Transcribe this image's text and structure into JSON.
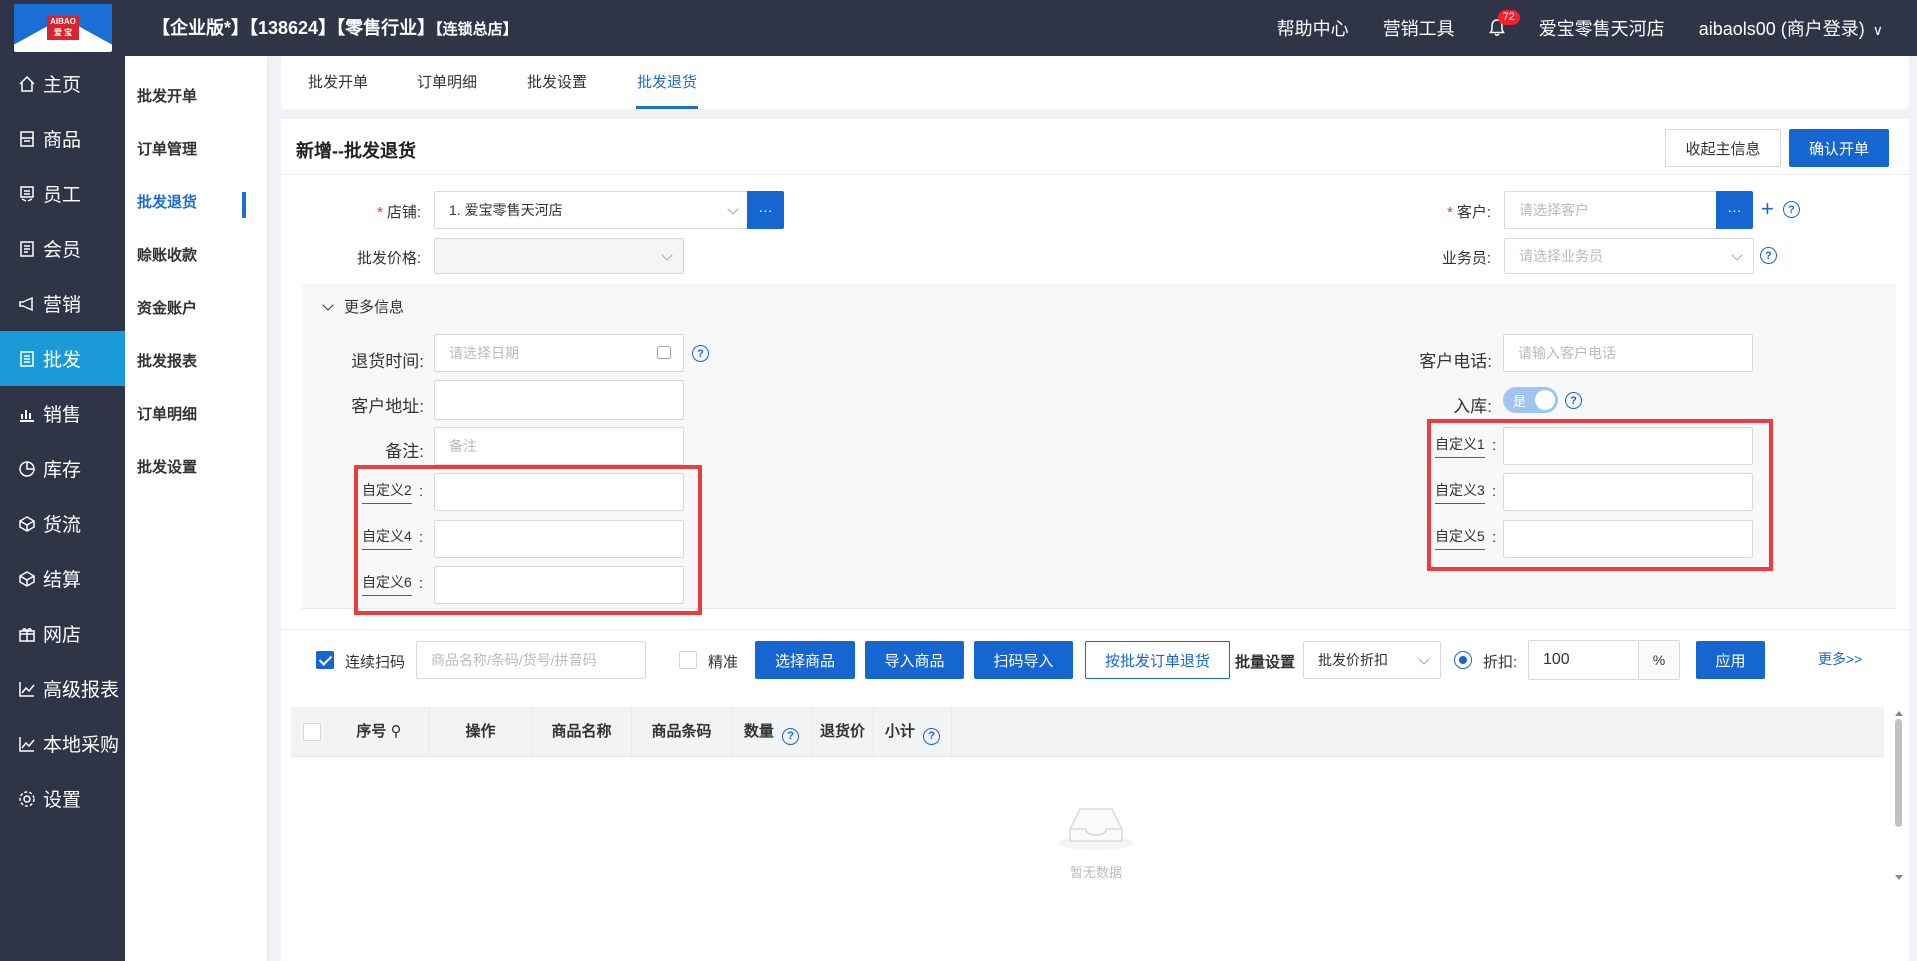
{
  "header": {
    "logo_text_top": "AIBAO",
    "logo_text_bottom": "爱 宝",
    "title_main": "【企业版*】【138624】【零售行业】",
    "title_small": "【连锁总店】",
    "help_center": "帮助中心",
    "marketing_tools": "营销工具",
    "notification_count": "72",
    "store_name": "爱宝零售天河店",
    "user": "aibaols00 (商户登录)"
  },
  "nav": [
    {
      "label": "主页",
      "icon": "home-icon"
    },
    {
      "label": "商品",
      "icon": "goods-icon"
    },
    {
      "label": "员工",
      "icon": "staff-icon"
    },
    {
      "label": "会员",
      "icon": "member-icon"
    },
    {
      "label": "营销",
      "icon": "megaphone-icon"
    },
    {
      "label": "批发",
      "icon": "list-icon",
      "active": true
    },
    {
      "label": "销售",
      "icon": "chart-icon"
    },
    {
      "label": "库存",
      "icon": "pie-icon"
    },
    {
      "label": "货流",
      "icon": "cube-icon"
    },
    {
      "label": "结算",
      "icon": "settle-icon"
    },
    {
      "label": "网店",
      "icon": "gift-icon"
    },
    {
      "label": "高级报表",
      "icon": "line-chart-icon"
    },
    {
      "label": "本地采购",
      "icon": "trend-icon"
    },
    {
      "label": "设置",
      "icon": "gear-icon"
    }
  ],
  "submenu": [
    "批发开单",
    "订单管理",
    "批发退货",
    "赊账收款",
    "资金账户",
    "批发报表",
    "订单明细",
    "批发设置"
  ],
  "submenu_active": 2,
  "tabs": [
    "批发开单",
    "订单明细",
    "批发设置",
    "批发退货"
  ],
  "tab_active": 3,
  "page": {
    "title": "新增--批发退货",
    "collapse_btn": "收起主信息",
    "confirm_btn": "确认开单"
  },
  "form": {
    "store_label": "店铺",
    "store_value": "1. 爱宝零售天河店",
    "price_label": "批发价格",
    "customer_label": "客户",
    "customer_placeholder": "请选择客户",
    "salesman_label": "业务员",
    "salesman_placeholder": "请选择业务员",
    "dots": "···",
    "more_info": "更多信息",
    "return_time_label": "退货时间",
    "return_time_placeholder": "请选择日期",
    "address_label": "客户地址",
    "remark_label": "备注",
    "remark_placeholder": "备注",
    "phone_label": "客户电话",
    "phone_placeholder": "请输入客户电话",
    "stock_in_label": "入库",
    "stock_in_value": "是",
    "custom2": "自定义2",
    "custom4": "自定义4",
    "custom6": "自定义6",
    "custom1": "自定义1",
    "custom3": "自定义3",
    "custom5": "自定义5",
    "colon": ":"
  },
  "toolbar": {
    "continuous_scan": "连续扫码",
    "search_placeholder": "商品名称/条码/货号/拼音码",
    "exact": "精准",
    "select_goods": "选择商品",
    "import_goods": "导入商品",
    "scan_import": "扫码导入",
    "by_order_return": "按批发订单退货",
    "batch_setting": "批量设置",
    "batch_option": "批发价折扣",
    "discount_label": "折扣:",
    "discount_value": "100",
    "percent": "%",
    "apply": "应用",
    "more": "更多>>"
  },
  "table": {
    "columns": [
      "序号",
      "操作",
      "商品名称",
      "商品条码",
      "数量",
      "退货价",
      "小计"
    ],
    "empty_text": "暂无数据"
  },
  "colors": {
    "accent": "#1666d1",
    "nav_bg": "#2f3447",
    "nav_active": "#1a9bd8",
    "highlight": "#ef3b3b"
  }
}
